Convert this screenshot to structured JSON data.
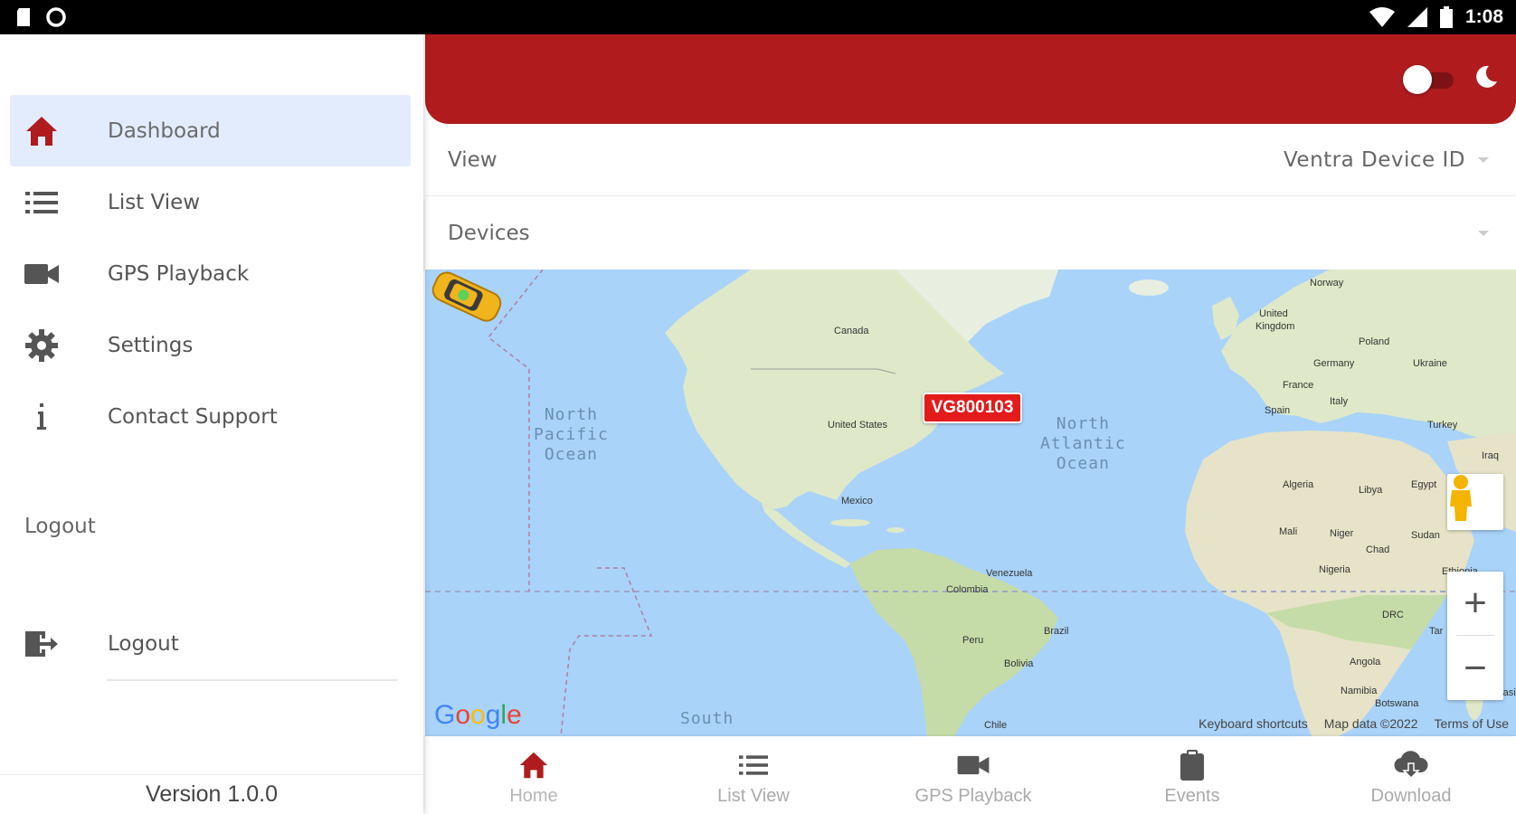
{
  "status_bar": {
    "time": "1:08",
    "icons": [
      "sd-card-icon",
      "circle-notification-icon",
      "wifi-icon",
      "signal-icon",
      "battery-icon"
    ]
  },
  "drawer": {
    "items": [
      {
        "label": "Dashboard",
        "icon": "home-icon",
        "active": true
      },
      {
        "label": "List View",
        "icon": "list-icon",
        "active": false
      },
      {
        "label": "GPS Playback",
        "icon": "video-camera-icon",
        "active": false
      },
      {
        "label": "Settings",
        "icon": "gear-icon",
        "active": false
      },
      {
        "label": "Contact Support",
        "icon": "info-icon",
        "active": false
      }
    ],
    "section_label": "Logout",
    "logout": {
      "label": "Logout",
      "icon": "logout-icon"
    },
    "version": "Version 1.0.0"
  },
  "header": {
    "dark_mode_toggle": false,
    "dark_mode_icon": "moon-icon"
  },
  "filters": {
    "view_label": "View",
    "view_value": "Ventra Device ID",
    "devices_label": "Devices"
  },
  "map": {
    "oceans": {
      "north_pacific": [
        "North",
        "Pacific",
        "Ocean"
      ],
      "north_atlantic": [
        "North",
        "Atlantic",
        "Ocean"
      ],
      "south": "South"
    },
    "places": {
      "canada": "Canada",
      "united_states": "United States",
      "mexico": "Mexico",
      "venezuela": "Venezuela",
      "colombia": "Colombia",
      "peru": "Peru",
      "brazil": "Brazil",
      "bolivia": "Bolivia",
      "chile": "Chile",
      "norway": "Norway",
      "united_kingdom": [
        "United",
        "Kingdom"
      ],
      "poland": "Poland",
      "germany": "Germany",
      "ukraine": "Ukraine",
      "france": "France",
      "spain": "Spain",
      "italy": "Italy",
      "turkey": "Turkey",
      "iraq": "Iraq",
      "algeria": "Algeria",
      "libya": "Libya",
      "egypt": "Egypt",
      "mali": "Mali",
      "niger": "Niger",
      "sudan": "Sudan",
      "chad": "Chad",
      "nigeria": "Nigeria",
      "ethiopia": "Ethiopia",
      "drc": "DRC",
      "tanzania": "Tar",
      "angola": "Angola",
      "namibia": "Namibia",
      "botswana": "Botswana",
      "madagascar": "Madagasi"
    },
    "device_id": "VG800103",
    "logo": "Google",
    "footer": [
      "Keyboard shortcuts",
      "Map data ©2022",
      "Terms of Use"
    ],
    "zoom_in": "+",
    "zoom_out": "−"
  },
  "bottom_nav": [
    {
      "label": "Home",
      "icon": "home-icon",
      "active": true
    },
    {
      "label": "List View",
      "icon": "list-icon",
      "active": false
    },
    {
      "label": "GPS Playback",
      "icon": "video-camera-icon",
      "active": false
    },
    {
      "label": "Events",
      "icon": "clipboard-icon",
      "active": false
    },
    {
      "label": "Download",
      "icon": "cloud-download-icon",
      "active": false
    }
  ],
  "colors": {
    "brand_red": "#b01b1e",
    "active_nav_bg": "#e3ecfd",
    "device_tag": "#e31b1b",
    "ocean": "#a9d3f9",
    "land": "#dfe9c9"
  }
}
